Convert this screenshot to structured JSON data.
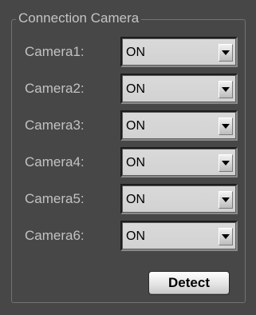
{
  "panel": {
    "title": "Connection Camera",
    "cameras": [
      {
        "label": "Camera1:",
        "value": "ON"
      },
      {
        "label": "Camera2:",
        "value": "ON"
      },
      {
        "label": "Camera3:",
        "value": "ON"
      },
      {
        "label": "Camera4:",
        "value": "ON"
      },
      {
        "label": "Camera5:",
        "value": "ON"
      },
      {
        "label": "Camera6:",
        "value": "ON"
      }
    ],
    "detect_label": "Detect"
  },
  "icons": {
    "dropdown": "chevron-down-icon"
  },
  "colors": {
    "background": "#474747",
    "label_text": "#c2c2c2",
    "select_bg": "#d6d6d6"
  }
}
